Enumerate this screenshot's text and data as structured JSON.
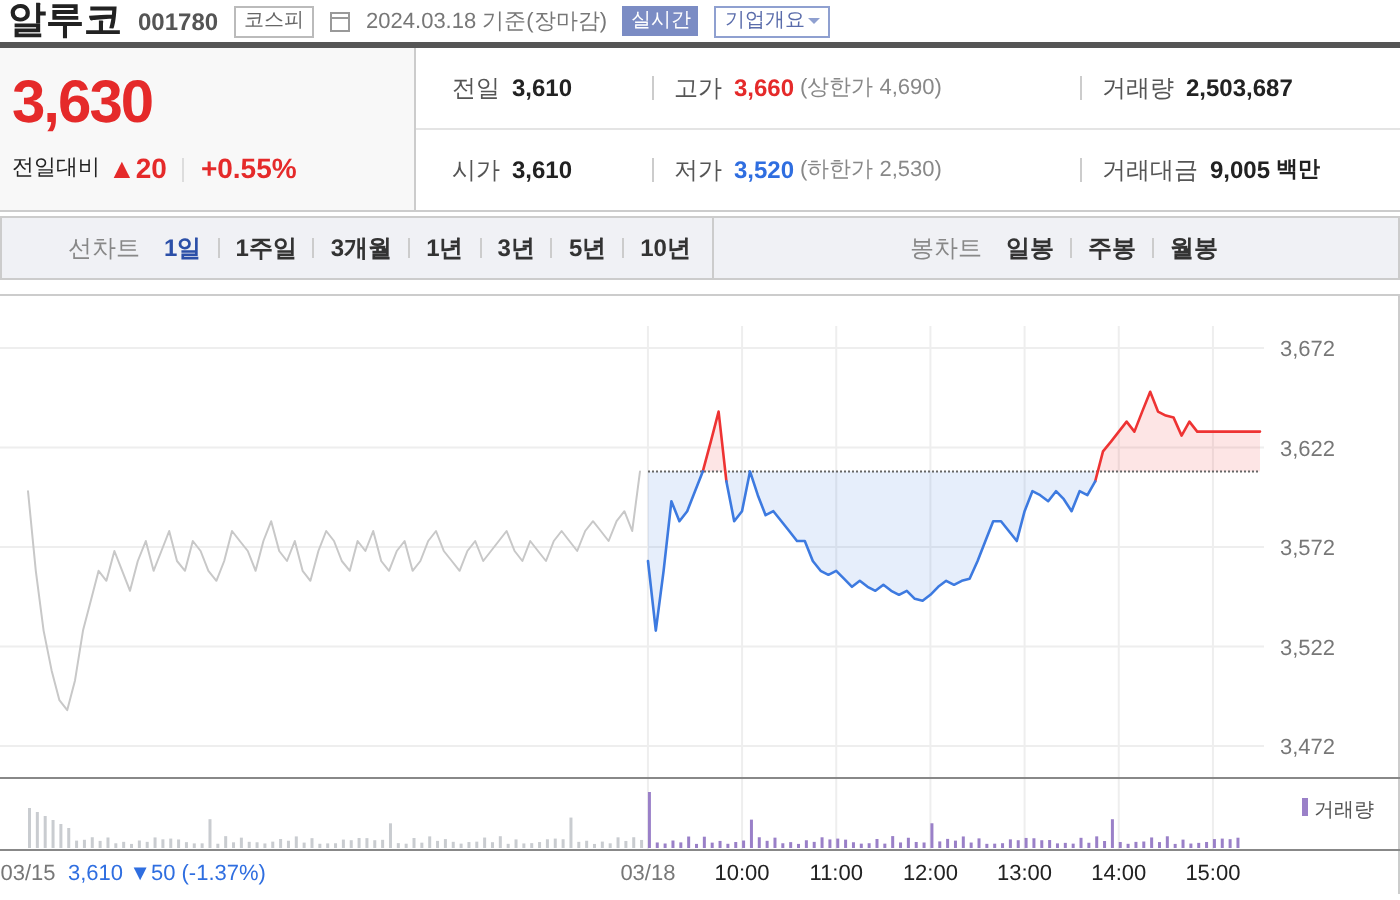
{
  "header": {
    "name": "알루코",
    "code": "001780",
    "market": "코스피",
    "date": "2024.03.18 기준(장마감)",
    "realtime_badge": "실시간",
    "company_menu": "기업개요"
  },
  "price": {
    "current": "3,630",
    "change_label": "전일대비",
    "change_symbol": "▲",
    "change": "20",
    "change_pct": "+0.55%"
  },
  "stats": [
    {
      "label": "전일",
      "value": "3,610"
    },
    {
      "label": "고가",
      "value": "3,660",
      "color": "#e52a2a",
      "note": "(상한가 4,690)"
    },
    {
      "label": "거래량",
      "value": "2,503,687"
    },
    {
      "label": "시가",
      "value": "3,610"
    },
    {
      "label": "저가",
      "value": "3,520",
      "color": "#2f6ee0",
      "note": "(하한가 2,530)"
    },
    {
      "label": "거래대금",
      "value": "9,005",
      "unit": "백만"
    }
  ],
  "line_chart_tabs": {
    "label": "선차트",
    "items": [
      {
        "label": "1일",
        "selected": true
      },
      {
        "label": "1주일",
        "selected": false
      },
      {
        "label": "3개월",
        "selected": false
      },
      {
        "label": "1년",
        "selected": false
      },
      {
        "label": "3년",
        "selected": false
      },
      {
        "label": "5년",
        "selected": false
      },
      {
        "label": "10년",
        "selected": false
      }
    ]
  },
  "candle_chart_tabs": {
    "label": "봉차트",
    "items": [
      {
        "label": "일봉",
        "selected": false
      },
      {
        "label": "주봉",
        "selected": false
      },
      {
        "label": "월봉",
        "selected": false
      }
    ]
  },
  "chart": {
    "prev_day_summary": "3,610 ▼50 (-1.37%)",
    "volume_legend": "거래량",
    "chart_data": {
      "type": "line",
      "grid": true,
      "ylim": [
        3472,
        3672
      ],
      "yticks": [
        {
          "value": 3672,
          "label": "3,672"
        },
        {
          "value": 3622,
          "label": "3,622"
        },
        {
          "value": 3572,
          "label": "3,572"
        },
        {
          "value": 3522,
          "label": "3,522"
        },
        {
          "value": 3472,
          "label": "3,472"
        }
      ],
      "categories": [
        "03/15",
        null,
        null,
        null,
        null,
        null,
        null,
        null,
        null,
        null,
        null,
        null,
        null,
        null,
        null,
        null,
        null,
        null,
        null,
        null,
        null,
        null,
        null,
        null,
        null,
        null,
        null,
        null,
        null,
        null,
        null,
        null,
        null,
        null,
        null,
        null,
        null,
        null,
        null,
        null,
        null,
        null,
        null,
        null,
        null,
        null,
        null,
        null,
        null,
        null,
        null,
        null,
        null,
        null,
        null,
        null,
        null,
        null,
        null,
        null,
        null,
        null,
        null,
        null,
        null,
        null,
        null,
        null,
        null,
        null,
        null,
        null,
        null,
        null,
        null,
        null,
        null,
        null,
        null,
        "03/18",
        null,
        null,
        null,
        null,
        null,
        null,
        null,
        null,
        null,
        null,
        null,
        "10:00",
        null,
        null,
        null,
        null,
        null,
        null,
        null,
        null,
        null,
        null,
        null,
        "11:00",
        null,
        null,
        null,
        null,
        null,
        null,
        null,
        null,
        null,
        null,
        null,
        "12:00",
        null,
        null,
        null,
        null,
        null,
        null,
        null,
        null,
        null,
        null,
        null,
        "13:00",
        null,
        null,
        null,
        null,
        null,
        null,
        null,
        null,
        null,
        null,
        null,
        "14:00",
        null,
        null,
        null,
        null,
        null,
        null,
        null,
        null,
        null,
        null,
        null,
        "15:00",
        null,
        null,
        null,
        null,
        null,
        null
      ],
      "series": [
        {
          "color": "#666666",
          "line_style": "dotted",
          "values": [
            null,
            null,
            null,
            null,
            null,
            null,
            null,
            null,
            null,
            null,
            null,
            null,
            null,
            null,
            null,
            null,
            null,
            null,
            null,
            null,
            null,
            null,
            null,
            null,
            null,
            null,
            null,
            null,
            null,
            null,
            null,
            null,
            null,
            null,
            null,
            null,
            null,
            null,
            null,
            null,
            null,
            null,
            null,
            null,
            null,
            null,
            null,
            null,
            null,
            null,
            null,
            null,
            null,
            null,
            null,
            null,
            null,
            null,
            null,
            null,
            null,
            null,
            null,
            null,
            null,
            null,
            null,
            null,
            null,
            null,
            null,
            null,
            null,
            null,
            null,
            null,
            null,
            null,
            null,
            3610,
            3610,
            3610,
            3610,
            3610,
            3610,
            3610,
            3610,
            3610,
            3610,
            3610,
            3610,
            3610,
            3610,
            3610,
            3610,
            3610,
            3610,
            3610,
            3610,
            3610,
            3610,
            3610,
            3610,
            3610,
            3610,
            3610,
            3610,
            3610,
            3610,
            3610,
            3610,
            3610,
            3610,
            3610,
            3610,
            3610,
            3610,
            3610,
            3610,
            3610,
            3610,
            3610,
            3610,
            3610,
            3610,
            3610,
            3610,
            3610,
            3610,
            3610,
            3610,
            3610,
            3610,
            3610,
            3610,
            3610,
            3610,
            3610,
            3610,
            3610,
            3610,
            3610,
            3610,
            3610,
            3610,
            3610,
            3610,
            3610,
            3610,
            3610,
            3610,
            3610,
            3610,
            3610,
            3610,
            3610,
            3610,
            3610
          ]
        },
        {
          "color": "#c8c8c8",
          "values": [
            3600,
            3560,
            3530,
            3510,
            3495,
            3490,
            3505,
            3530,
            3545,
            3560,
            3555,
            3570,
            3560,
            3550,
            3565,
            3575,
            3560,
            3570,
            3580,
            3565,
            3560,
            3575,
            3570,
            3560,
            3555,
            3565,
            3580,
            3575,
            3570,
            3560,
            3575,
            3585,
            3570,
            3565,
            3575,
            3560,
            3555,
            3570,
            3580,
            3575,
            3565,
            3560,
            3575,
            3570,
            3580,
            3565,
            3560,
            3570,
            3575,
            3560,
            3565,
            3575,
            3580,
            3570,
            3565,
            3560,
            3570,
            3575,
            3565,
            3570,
            3575,
            3580,
            3570,
            3565,
            3575,
            3570,
            3565,
            3575,
            3580,
            3575,
            3570,
            3580,
            3585,
            3580,
            3575,
            3585,
            3590,
            3580,
            3610,
            null,
            null,
            null,
            null,
            null,
            null,
            null,
            null,
            null,
            null,
            null,
            null,
            null,
            null,
            null,
            null,
            null,
            null,
            null,
            null,
            null,
            null,
            null,
            null,
            null,
            null,
            null,
            null,
            null,
            null,
            null,
            null,
            null,
            null,
            null,
            null,
            null,
            null,
            null,
            null,
            null,
            null,
            null,
            null,
            null,
            null,
            null,
            null,
            null,
            null,
            null,
            null,
            null,
            null,
            null,
            null,
            null,
            null,
            null,
            null,
            null,
            null,
            null,
            null,
            null,
            null,
            null,
            null,
            null,
            null,
            null,
            null,
            null,
            null,
            null,
            null,
            null,
            null,
            null
          ]
        },
        {
          "color": "#ee3333",
          "values": [
            null,
            null,
            null,
            null,
            null,
            null,
            null,
            null,
            null,
            null,
            null,
            null,
            null,
            null,
            null,
            null,
            null,
            null,
            null,
            null,
            null,
            null,
            null,
            null,
            null,
            null,
            null,
            null,
            null,
            null,
            null,
            null,
            null,
            null,
            null,
            null,
            null,
            null,
            null,
            null,
            null,
            null,
            null,
            null,
            null,
            null,
            null,
            null,
            null,
            null,
            null,
            null,
            null,
            null,
            null,
            null,
            null,
            null,
            null,
            null,
            null,
            null,
            null,
            null,
            null,
            null,
            null,
            null,
            null,
            null,
            null,
            null,
            null,
            null,
            null,
            null,
            null,
            null,
            null,
            null,
            null,
            null,
            null,
            null,
            null,
            null,
            3610,
            3625,
            3640,
            3605,
            null,
            null,
            null,
            null,
            null,
            null,
            null,
            null,
            null,
            null,
            null,
            null,
            null,
            null,
            null,
            null,
            null,
            null,
            null,
            null,
            null,
            null,
            null,
            null,
            null,
            null,
            null,
            null,
            null,
            null,
            null,
            null,
            null,
            null,
            null,
            null,
            null,
            null,
            null,
            null,
            null,
            null,
            null,
            null,
            null,
            null,
            3605,
            3620,
            3625,
            3630,
            3635,
            3630,
            3640,
            3650,
            3640,
            3638,
            3637,
            3628,
            3635,
            3630,
            3630,
            3630,
            3630,
            3630,
            3630,
            3630,
            3630,
            3630
          ]
        },
        {
          "color": "#3d7ae0",
          "values": [
            null,
            null,
            null,
            null,
            null,
            null,
            null,
            null,
            null,
            null,
            null,
            null,
            null,
            null,
            null,
            null,
            null,
            null,
            null,
            null,
            null,
            null,
            null,
            null,
            null,
            null,
            null,
            null,
            null,
            null,
            null,
            null,
            null,
            null,
            null,
            null,
            null,
            null,
            null,
            null,
            null,
            null,
            null,
            null,
            null,
            null,
            null,
            null,
            null,
            null,
            null,
            null,
            null,
            null,
            null,
            null,
            null,
            null,
            null,
            null,
            null,
            null,
            null,
            null,
            null,
            null,
            null,
            null,
            null,
            null,
            null,
            null,
            null,
            null,
            null,
            null,
            null,
            null,
            null,
            3565,
            3530,
            3560,
            3595,
            3585,
            3590,
            3600,
            3610,
            null,
            null,
            3605,
            3585,
            3590,
            3610,
            3598,
            3588,
            3590,
            3585,
            3580,
            3575,
            3575,
            3565,
            3560,
            3558,
            3560,
            3556,
            3552,
            3555,
            3552,
            3550,
            3553,
            3550,
            3548,
            3550,
            3546,
            3545,
            3548,
            3552,
            3555,
            3553,
            3555,
            3556,
            3565,
            3575,
            3585,
            3585,
            3580,
            3575,
            3590,
            3600,
            3598,
            3595,
            3600,
            3596,
            3590,
            3600,
            3598,
            3605,
            null,
            null,
            null,
            null,
            null,
            null,
            null,
            null,
            null,
            null,
            null,
            null,
            null,
            null,
            null,
            null,
            null,
            null,
            null,
            null,
            null
          ]
        }
      ]
    }
  }
}
